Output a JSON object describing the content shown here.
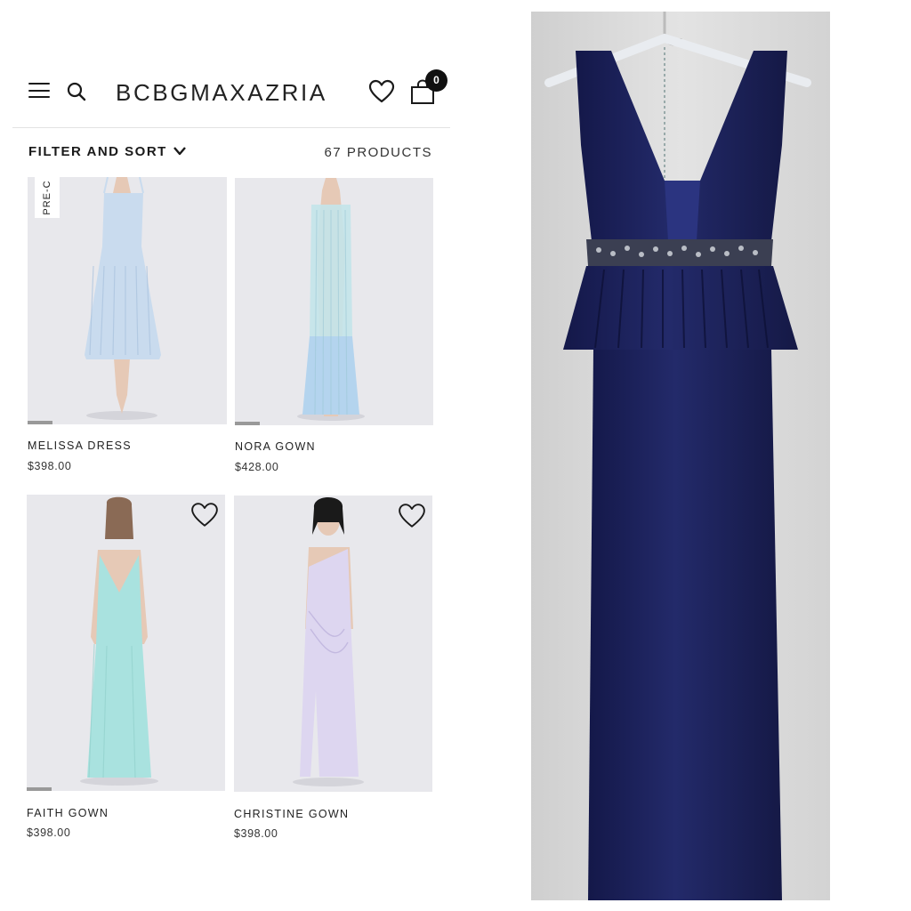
{
  "header": {
    "logo": "BCBGMAXAZRIA",
    "cart_count": "0",
    "icons": [
      "hamburger-menu-icon",
      "search-icon",
      "heart-icon",
      "shopping-bag-icon"
    ]
  },
  "toolbar": {
    "filter_label": "FILTER AND SORT",
    "product_count": "67 PRODUCTS"
  },
  "products": [
    {
      "name": "MELISSA DRESS",
      "price": "$398.00",
      "badge": "PRE-C",
      "color": "#c9dbee"
    },
    {
      "name": "NORA GOWN",
      "price": "$428.00",
      "color": "#c3e4ea"
    },
    {
      "name": "FAITH GOWN",
      "price": "$398.00",
      "color": "#a9e2df"
    },
    {
      "name": "CHRISTINE GOWN",
      "price": "$398.00",
      "color": "#ddd6f0"
    }
  ],
  "photo": {
    "garment_color": "#1b2056",
    "background_color": "#d9d9d9"
  }
}
